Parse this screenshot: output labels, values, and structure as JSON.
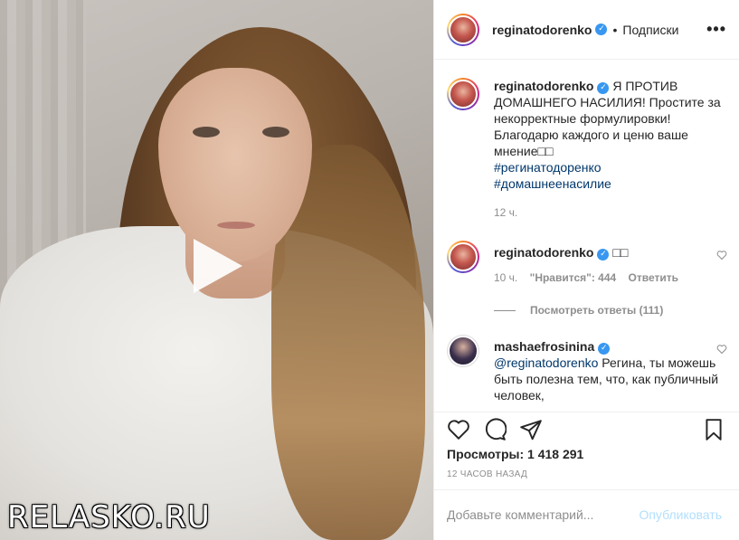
{
  "media": {
    "play_icon": "play-icon",
    "watermark": "RELASKO.RU"
  },
  "header": {
    "username": "reginatodorenko",
    "verified_icon": "verified-badge-icon",
    "separator": "•",
    "follow_label": "Подписки",
    "more_icon": "more-options-icon",
    "more_glyph": "•••"
  },
  "comments": [
    {
      "username": "reginatodorenko",
      "text_main": "Я ПРОТИВ ДОМАШНЕГО НАСИЛИЯ! Простите за некорректные формулировки! Благодарю каждого и ценю ваше мнение",
      "emoji": "□□",
      "hashtags": [
        "#регинатодоренко",
        "#домашнеенасилие"
      ],
      "time": "12 ч."
    },
    {
      "username": "reginatodorenko",
      "text": "□□",
      "time": "10 ч.",
      "likes": "\"Нравится\": 444",
      "reply": "Ответить",
      "view_replies": "Посмотреть ответы (111)"
    },
    {
      "username": "mashaefrosinina",
      "mention": "@reginatodorenko",
      "text": "Регина, ты можешь быть полезна тем, что, как публичный человек,"
    }
  ],
  "actions": {
    "like_icon": "heart-icon",
    "comment_icon": "comment-icon",
    "share_icon": "share-icon",
    "save_icon": "bookmark-icon"
  },
  "stats": {
    "views": "Просмотры: 1 418 291",
    "time_ago": "12 ЧАСОВ НАЗАД"
  },
  "comment_form": {
    "placeholder": "Добавьте комментарий...",
    "publish_label": "Опубликовать"
  },
  "colors": {
    "link": "#00376b",
    "verified": "#3897f0",
    "muted": "#8e8e8e",
    "publish_disabled": "#b2dffc"
  }
}
